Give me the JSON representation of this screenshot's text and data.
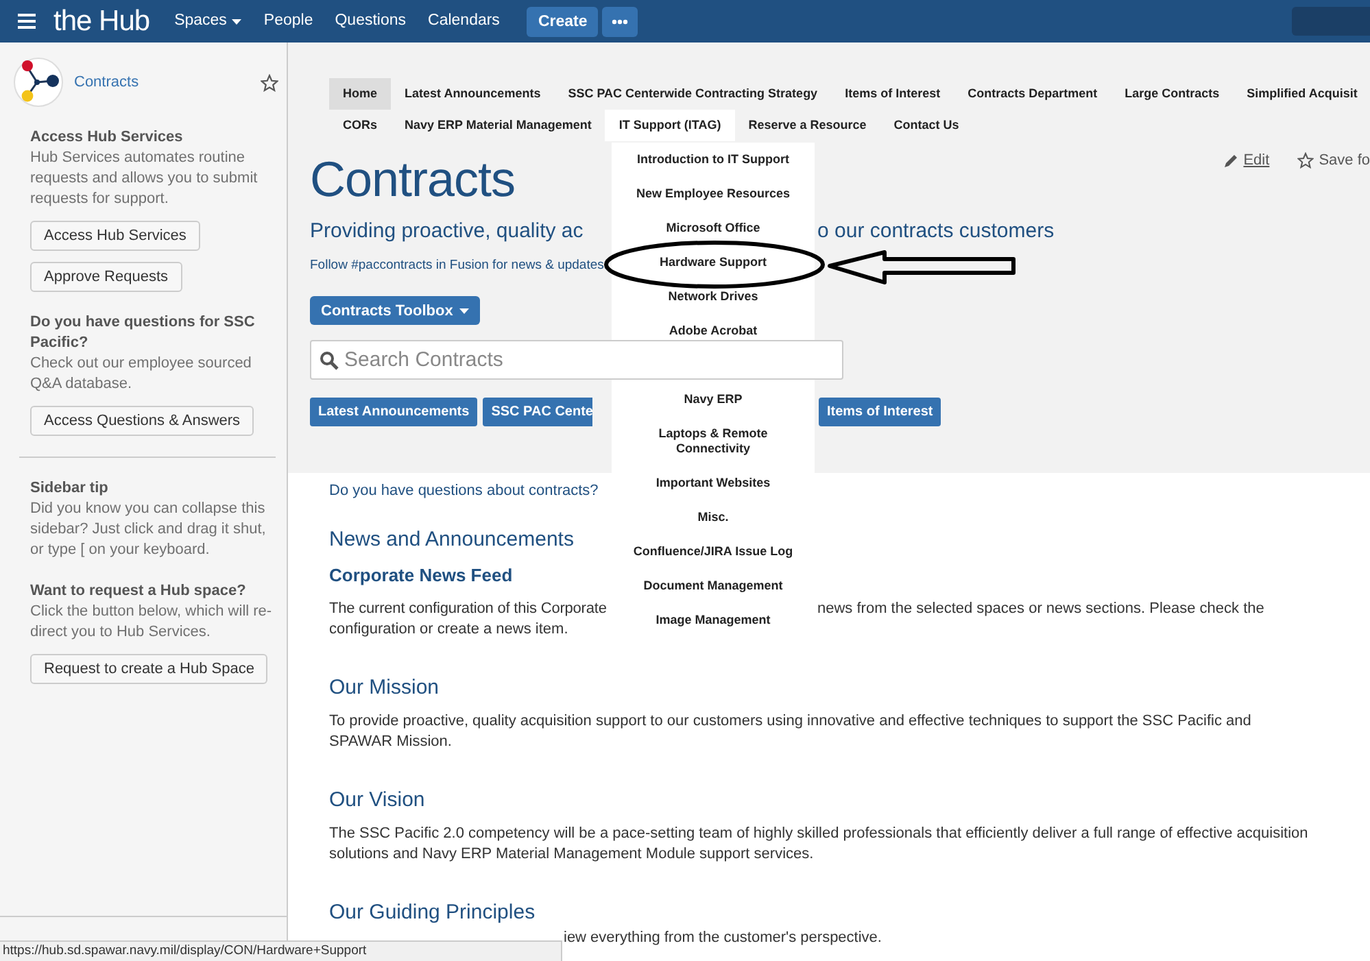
{
  "top_nav": {
    "brand": "the Hub",
    "items": [
      {
        "label": "Spaces",
        "has_menu": true
      },
      {
        "label": "People",
        "has_menu": false
      },
      {
        "label": "Questions",
        "has_menu": false
      },
      {
        "label": "Calendars",
        "has_menu": false
      }
    ],
    "create_button": "Create"
  },
  "sidebar": {
    "space_name": "Contracts",
    "groups": [
      [
        {
          "heading": "Access Hub Services",
          "text": "Hub Services automates routine requests and allows you to submit requests for support.",
          "buttons": [
            "Access Hub Services",
            "Approve Requests"
          ]
        },
        {
          "heading": "Do you have questions for SSC Pacific?",
          "text": "Check out our employee sourced Q&A database.",
          "buttons": [
            "Access Questions & Answers"
          ]
        }
      ],
      [
        {
          "heading": "Sidebar tip",
          "text": "Did you know you can collapse this sidebar? Just click and drag it shut, or type [ on your keyboard."
        },
        {
          "heading": "Want to request a Hub space?",
          "text": "Click the button below, which will re-direct you to Hub Services.",
          "buttons": [
            "Request to create a Hub Space"
          ]
        }
      ]
    ]
  },
  "page_nav": {
    "rows": [
      {
        "tabs": [
          {
            "label": "Home",
            "selected": true,
            "expanded": false
          },
          {
            "label": "Latest Announcements",
            "selected": false,
            "expanded": false
          },
          {
            "label": "SSC PAC Centerwide Contracting Strategy",
            "selected": false,
            "expanded": false
          },
          {
            "label": "Items of Interest",
            "selected": false,
            "expanded": false
          },
          {
            "label": "Contracts Department",
            "selected": false,
            "expanded": false
          },
          {
            "label": "Large Contracts",
            "selected": false,
            "expanded": false
          },
          {
            "label": "Simplified Acquisit",
            "selected": false,
            "expanded": false
          }
        ]
      },
      {
        "tabs": [
          {
            "label": "CORs",
            "selected": false,
            "expanded": false
          },
          {
            "label": "Navy ERP Material Management",
            "selected": false,
            "expanded": false
          },
          {
            "label": "IT Support (ITAG)",
            "selected": false,
            "expanded": true
          },
          {
            "label": "Reserve a Resource",
            "selected": false,
            "expanded": false
          },
          {
            "label": "Contact Us",
            "selected": false,
            "expanded": false
          }
        ]
      }
    ]
  },
  "dropdown": {
    "groups": [
      [
        "Introduction to IT Support",
        "New Employee Resources",
        "Microsoft Office",
        "Hardware Support",
        "Network Drives",
        "Adobe Acrobat"
      ],
      [
        "Navy ERP",
        "Laptops & Remote Connectivity",
        "Important Websites",
        "Misc.",
        "Confluence/JIRA Issue Log",
        "Document Management",
        "Image Management"
      ]
    ]
  },
  "page_actions": [
    {
      "kind": "edit",
      "label": "Edit"
    },
    {
      "kind": "save",
      "label": "Save fo"
    }
  ],
  "header": {
    "title": "Contracts",
    "tagline_parts": [
      "Providing proactive, quality ac",
      "o our contracts customers"
    ],
    "follow_text": "Follow #paccontracts in Fusion for news & updates.",
    "toolbox_button": "Contracts Toolbox",
    "search": {
      "placeholder": "Search Contracts"
    },
    "quick_buttons": [
      "Latest Announcements",
      "SSC PAC Cente",
      "Items of Interest"
    ]
  },
  "content": {
    "question": "Do you have questions about contracts?",
    "news": {
      "heading": "News and Announcements",
      "feed_title": "Corporate News Feed",
      "text_parts": [
        "The current configuration of this Corporate",
        "news from the selected spaces or news sections. Please check the",
        "configuration or create a news item."
      ]
    },
    "sections": [
      {
        "kind": "full",
        "heading": "Our Mission",
        "text": "To provide proactive, quality acquisition support to our customers using innovative and effective techniques to support the SSC Pacific and SPAWAR Mission."
      },
      {
        "kind": "full",
        "heading": "Our Vision",
        "text": "The SSC Pacific 2.0 competency will be a pace-setting team of highly skilled professionals that efficiently deliver a full range of effective acquisition solutions and Navy ERP Material Management Module support services."
      },
      {
        "kind": "partial",
        "heading": "Our Guiding Principles",
        "text": "iew everything from the customer's perspective."
      }
    ]
  },
  "status_bar": {
    "url": "https://hub.sd.spawar.navy.mil/display/CON/Hardware+Support"
  }
}
